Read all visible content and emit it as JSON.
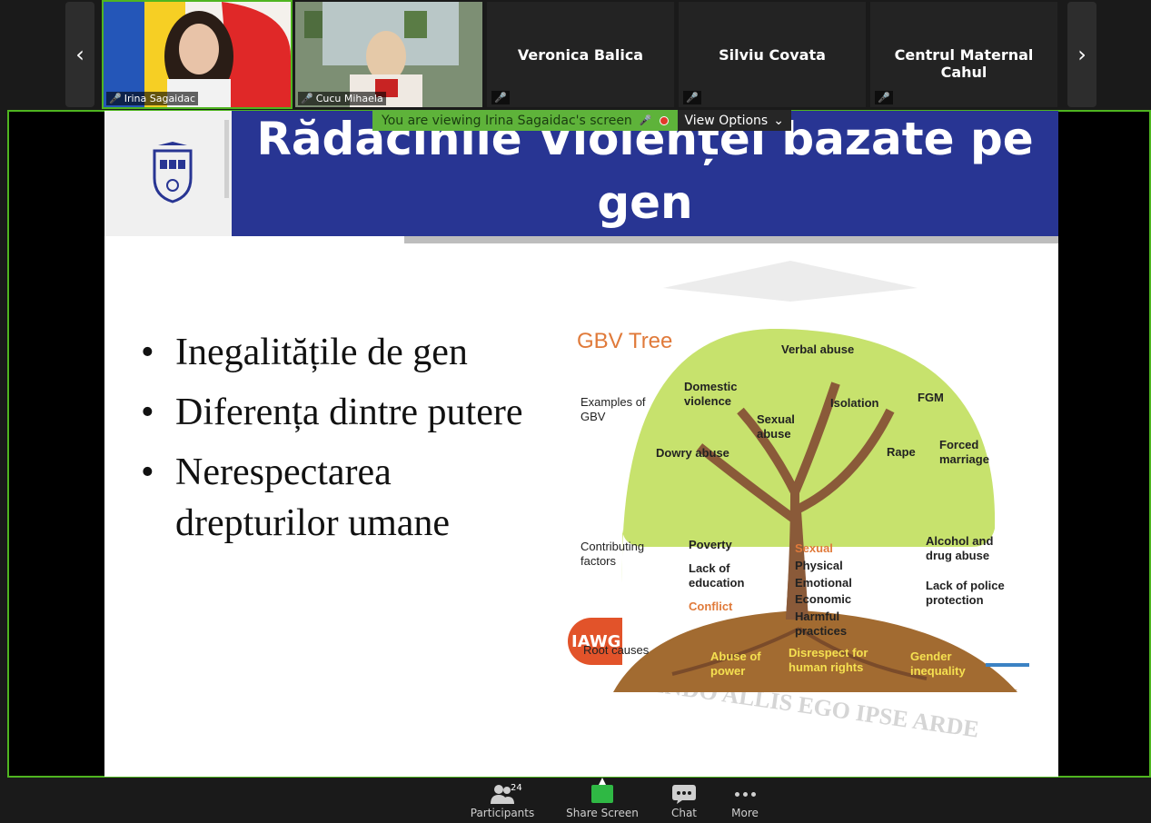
{
  "participants_strip": {
    "prev_icon": "chevron-left-icon",
    "next_icon": "chevron-right-icon",
    "tiles": [
      {
        "name": "Irina Sagaidac",
        "video": true
      },
      {
        "name": "Cucu Mihaela",
        "video": true
      },
      {
        "name": "Veronica Balica",
        "video": false
      },
      {
        "name": "Silviu Covata",
        "video": false
      },
      {
        "name": "Centrul Maternal Cahul",
        "video": false
      }
    ]
  },
  "share_banner": {
    "viewing_text": "You are viewing Irina Sagaidac's screen",
    "view_options": "View Options"
  },
  "slide": {
    "title": "Rădacinile Violenței bazate pe gen",
    "bullets": [
      "Inegalitățile de gen",
      "Diferența dintre putere",
      "Nerespectarea drepturilor umane"
    ],
    "watermark": "CENDO ALLIS EGO IPSE ARDE",
    "gbv_tree": {
      "heading": "GBV Tree",
      "examples_label": "Examples of GBV",
      "examples": [
        "Verbal abuse",
        "Domestic violence",
        "Isolation",
        "FGM",
        "Sexual abuse",
        "Dowry abuse",
        "Rape",
        "Forced marriage"
      ],
      "contributing_label": "Contributing factors",
      "contributing_left": [
        "Poverty",
        "Lack of education",
        "Conflict"
      ],
      "contributing_right": [
        "Alcohol and drug abuse",
        "Lack of police protection"
      ],
      "trunk_items": [
        "Sexual",
        "Physical",
        "Emotional",
        "Economic",
        "Harmful practices"
      ],
      "root_label": "Root causes",
      "roots": [
        "Abuse of power",
        "Disrespect for human rights",
        "Gender inequality"
      ],
      "logo_text": "IAWG"
    }
  },
  "toolbar": {
    "participants_label": "Participants",
    "participants_count": "24",
    "share_label": "Share Screen",
    "chat_label": "Chat",
    "more_label": "More"
  }
}
